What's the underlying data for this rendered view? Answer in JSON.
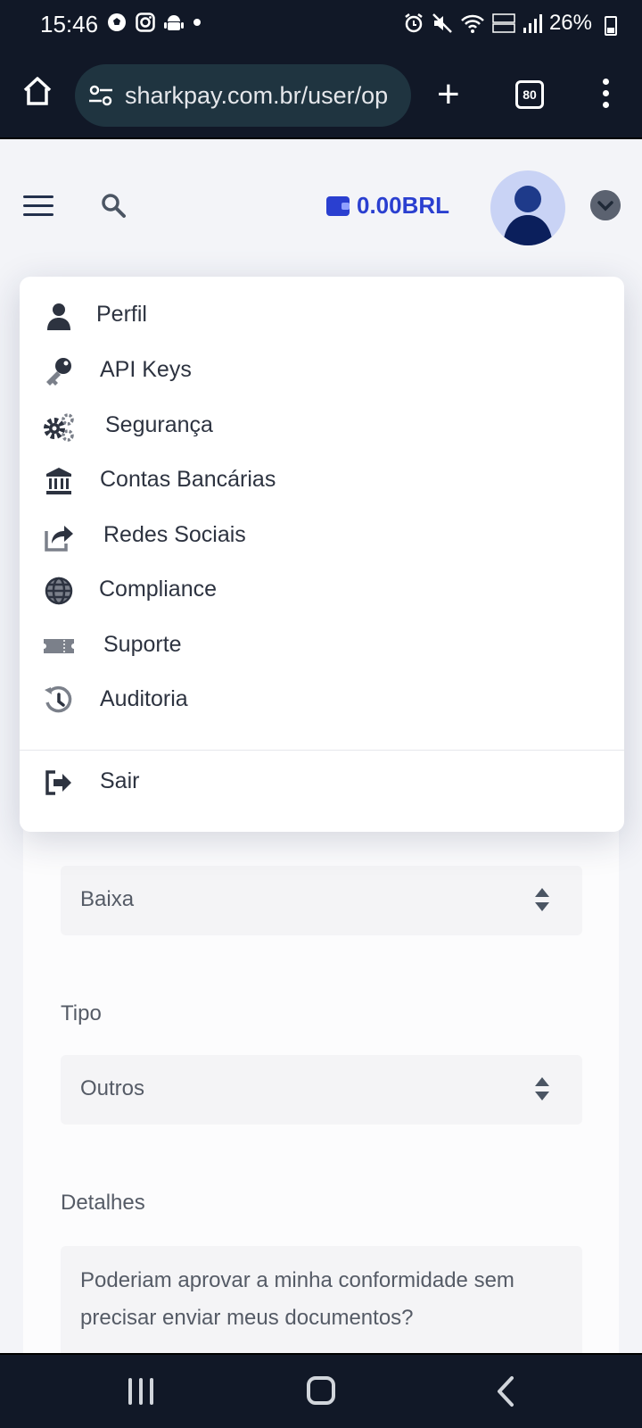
{
  "status_bar": {
    "time": "15:46",
    "battery": "26%"
  },
  "browser": {
    "url": "sharkpay.com.br/user/op",
    "tab_count": "80"
  },
  "header": {
    "balance": "0.00BRL"
  },
  "menu": {
    "items": [
      {
        "label": "Perfil",
        "icon": "user-icon"
      },
      {
        "label": "API Keys",
        "icon": "key-icon"
      },
      {
        "label": "Segurança",
        "icon": "gears-icon"
      },
      {
        "label": "Contas Bancárias",
        "icon": "bank-icon"
      },
      {
        "label": "Redes Sociais",
        "icon": "share-icon"
      },
      {
        "label": "Compliance",
        "icon": "globe-icon"
      },
      {
        "label": "Suporte",
        "icon": "ticket-icon"
      },
      {
        "label": "Auditoria",
        "icon": "history-icon"
      }
    ],
    "logout": {
      "label": "Sair",
      "icon": "logout-icon"
    }
  },
  "form": {
    "priority_value": "Baixa",
    "type_label": "Tipo",
    "type_value": "Outros",
    "details_label": "Detalhes",
    "details_value": "Poderiam aprovar a minha conformidade sem precisar enviar meus documentos?"
  },
  "colors": {
    "system_bar": "#111827",
    "brand_blue": "#2a3fd0",
    "menu_text": "#2d3340"
  }
}
